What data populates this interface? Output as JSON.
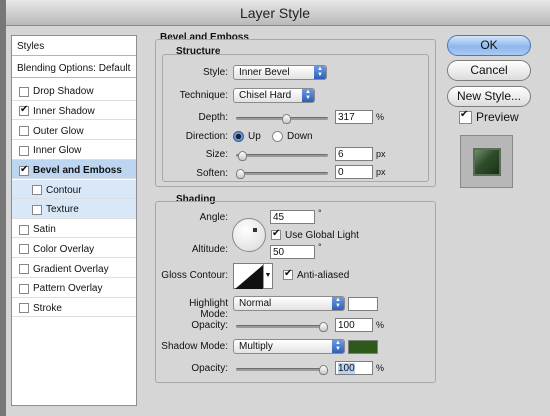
{
  "window": {
    "title": "Layer Style"
  },
  "left_panel": {
    "header_styles": "Styles",
    "header_blending": "Blending Options: Default",
    "items": [
      {
        "label": "Drop Shadow",
        "checked": false
      },
      {
        "label": "Inner Shadow",
        "checked": true
      },
      {
        "label": "Outer Glow",
        "checked": false
      },
      {
        "label": "Inner Glow",
        "checked": false
      },
      {
        "label": "Bevel and Emboss",
        "checked": true,
        "selected": true
      },
      {
        "label": "Contour",
        "checked": false,
        "sub": true
      },
      {
        "label": "Texture",
        "checked": false,
        "sub": true
      },
      {
        "label": "Satin",
        "checked": false
      },
      {
        "label": "Color Overlay",
        "checked": false
      },
      {
        "label": "Gradient Overlay",
        "checked": false
      },
      {
        "label": "Pattern Overlay",
        "checked": false
      },
      {
        "label": "Stroke",
        "checked": false
      }
    ]
  },
  "bevel": {
    "section_title": "Bevel and Emboss",
    "structure": {
      "title": "Structure",
      "style_label": "Style:",
      "style_value": "Inner Bevel",
      "technique_label": "Technique:",
      "technique_value": "Chisel Hard",
      "depth_label": "Depth:",
      "depth_value": "317",
      "depth_unit": "%",
      "depth_level": 0.55,
      "direction_label": "Direction:",
      "dir_up": "Up",
      "dir_down": "Down",
      "direction": "Up",
      "size_label": "Size:",
      "size_value": "6",
      "size_unit": "px",
      "size_level": 0.03,
      "soften_label": "Soften:",
      "soften_value": "0",
      "soften_unit": "px",
      "soften_level": 0.0
    },
    "shading": {
      "title": "Shading",
      "angle_label": "Angle:",
      "angle_value": "45",
      "angle_unit": "°",
      "global_light_label": "Use Global Light",
      "global_light": true,
      "altitude_label": "Altitude:",
      "altitude_value": "50",
      "altitude_unit": "°",
      "gloss_label": "Gloss Contour:",
      "antialiased_label": "Anti-aliased",
      "antialiased": true,
      "highlight_mode_label": "Highlight Mode:",
      "highlight_mode_value": "Normal",
      "highlight_color": "#ffffff",
      "opacity_label": "Opacity:",
      "highlight_opacity": "100",
      "highlight_opacity_unit": "%",
      "highlight_opacity_level": 1.0,
      "shadow_mode_label": "Shadow Mode:",
      "shadow_mode_value": "Multiply",
      "shadow_color": "#2d5a1a",
      "shadow_opacity_label": "Opacity:",
      "shadow_opacity": "100",
      "shadow_opacity_unit": "%",
      "shadow_opacity_level": 1.0
    }
  },
  "buttons": {
    "ok": "OK",
    "cancel": "Cancel",
    "new_style": "New Style...",
    "preview_label": "Preview",
    "preview_checked": true
  },
  "colors": {
    "accent": "#3e72c8",
    "selection": "#bcd6f1",
    "preview_fill": "#2f4d2a"
  }
}
